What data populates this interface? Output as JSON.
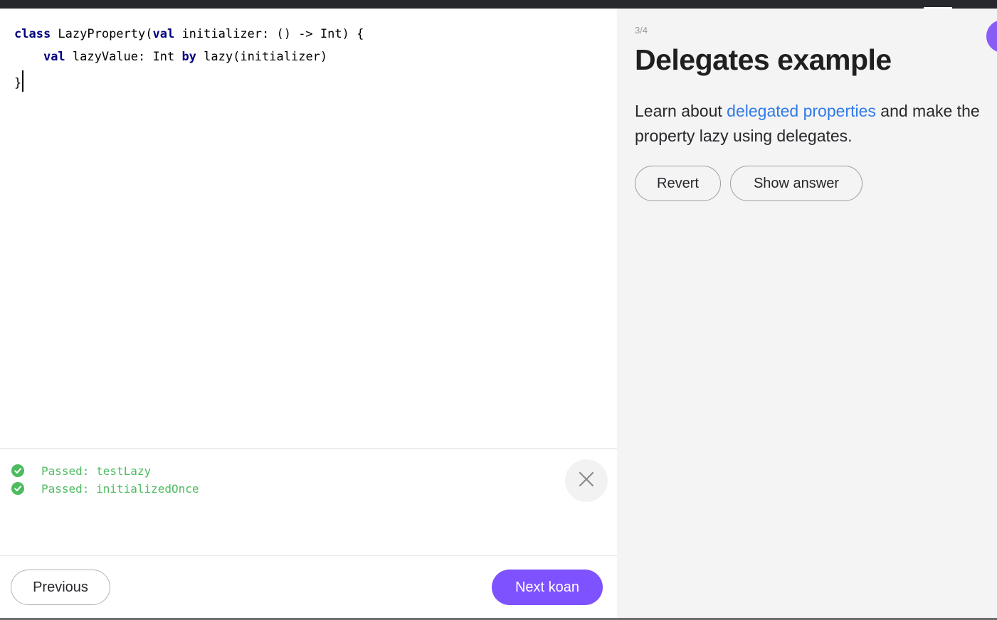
{
  "editor": {
    "code_lines": [
      [
        {
          "t": "class",
          "kw": true
        },
        {
          "t": " LazyProperty(",
          "kw": false
        },
        {
          "t": "val",
          "kw": true
        },
        {
          "t": " initializer: () -> Int) {",
          "kw": false
        }
      ],
      [
        {
          "t": "    ",
          "kw": false
        },
        {
          "t": "val",
          "kw": true
        },
        {
          "t": " lazyValue: Int ",
          "kw": false
        },
        {
          "t": "by",
          "kw": true
        },
        {
          "t": " lazy(initializer)",
          "kw": false
        }
      ],
      [
        {
          "t": "}",
          "kw": false
        }
      ]
    ],
    "cursor_line": 2
  },
  "console": {
    "results": [
      {
        "status_icon": "check-circle-icon",
        "text": "Passed: testLazy"
      },
      {
        "status_icon": "check-circle-icon",
        "text": "Passed: initializedOnce"
      }
    ],
    "close_icon": "close-icon"
  },
  "footer": {
    "previous_label": "Previous",
    "next_label": "Next koan"
  },
  "description": {
    "step": "3/4",
    "title": "Delegates example",
    "paragraph_before_link": "Learn about ",
    "link_text": "delegated properties",
    "paragraph_after_link": " and make the property lazy using delegates.",
    "revert_label": "Revert",
    "show_answer_label": "Show answer"
  },
  "colors": {
    "accent": "#7f52ff",
    "pass_green": "#4dbb5f",
    "link_blue": "#307ae8",
    "keyword_navy": "#000080",
    "side_panel_bg": "#f4f4f4",
    "topbar_bg": "#27282c"
  }
}
